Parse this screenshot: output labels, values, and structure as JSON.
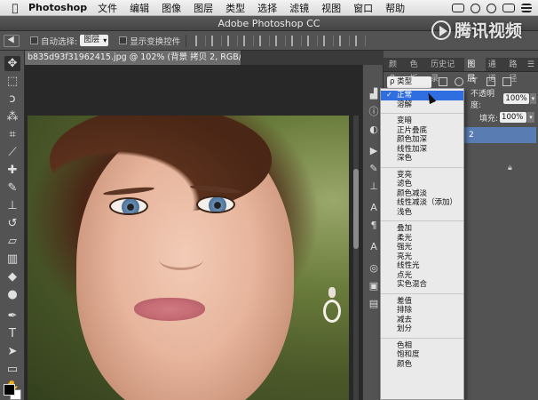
{
  "menubar": {
    "app": "Photoshop",
    "items": [
      "文件",
      "编辑",
      "图像",
      "图层",
      "类型",
      "选择",
      "滤镜",
      "视图",
      "窗口",
      "帮助"
    ]
  },
  "window": {
    "title": "Adobe Photoshop CC"
  },
  "options": {
    "auto_select_label": "自动选择:",
    "auto_select_value": "图层",
    "show_transform_label": "显示变换控件"
  },
  "watermark": {
    "text": "腾讯视频"
  },
  "document": {
    "tab_title": "b835d93f31962415.jpg @ 102% (背景 拷贝 2, RGB/8#) *"
  },
  "panel": {
    "tabs": [
      "颜色",
      "色板",
      "历史记录",
      "图层",
      "通道",
      "路径"
    ],
    "active_tab": "图层",
    "kind_filter": "ρ 类型",
    "opacity_label": "不透明度:",
    "opacity_value": "100%",
    "fill_label": "填充:",
    "fill_value": "100%",
    "layer_name_fragment": "2"
  },
  "blend_modes": {
    "selected": "正常",
    "groups": [
      [
        "正常",
        "溶解"
      ],
      [
        "变暗",
        "正片叠底",
        "颜色加深",
        "线性加深",
        "深色"
      ],
      [
        "变亮",
        "滤色",
        "颜色减淡",
        "线性减淡（添加）",
        "浅色"
      ],
      [
        "叠加",
        "柔光",
        "强光",
        "亮光",
        "线性光",
        "点光",
        "实色混合"
      ],
      [
        "差值",
        "排除",
        "减去",
        "划分"
      ],
      [
        "色相",
        "饱和度",
        "颜色"
      ]
    ]
  },
  "colors": {
    "foreground": "#000000",
    "background": "#ffffff",
    "selection": "#2f6ee0",
    "active_layer": "#597db2"
  }
}
